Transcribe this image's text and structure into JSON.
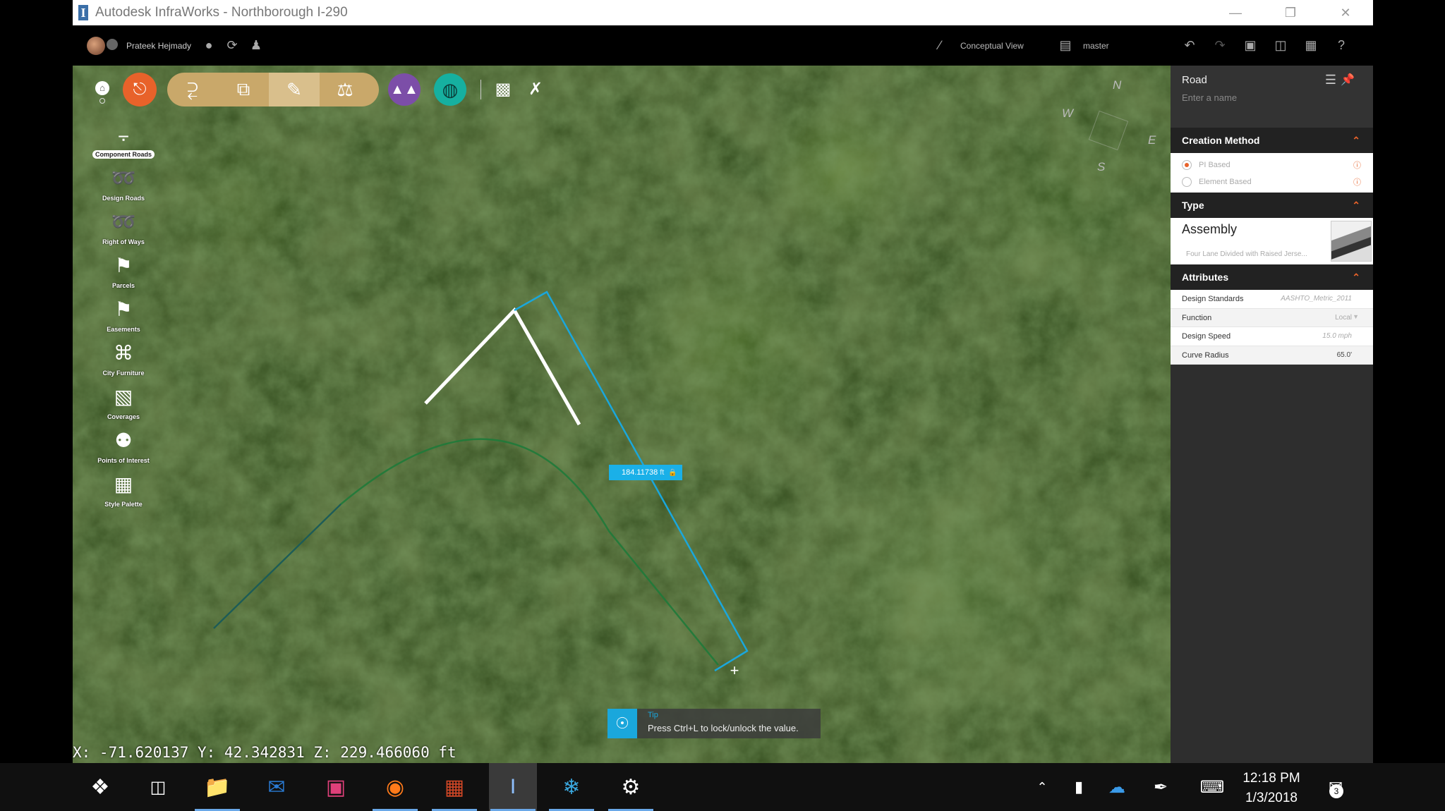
{
  "window": {
    "title": "Autodesk InfraWorks - Northborough I-290",
    "app_icon": "I",
    "controls": [
      "minimize-icon",
      "restore-icon",
      "close-icon"
    ]
  },
  "header": {
    "user_name": "Prateek Hejmady",
    "view_mode": "Conceptual View",
    "branch": "master"
  },
  "left_tools": [
    {
      "label": "Component Roads",
      "icon": "component-roads-icon",
      "active": true
    },
    {
      "label": "Design Roads",
      "icon": "design-roads-icon"
    },
    {
      "label": "Right of Ways",
      "icon": "right-of-ways-icon"
    },
    {
      "label": "Parcels",
      "icon": "parcels-icon"
    },
    {
      "label": "Easements",
      "icon": "easements-icon"
    },
    {
      "label": "City Furniture",
      "icon": "city-furniture-icon"
    },
    {
      "label": "Coverages",
      "icon": "coverages-icon"
    },
    {
      "label": "Points of Interest",
      "icon": "points-of-interest-icon"
    },
    {
      "label": "Style Palette",
      "icon": "style-palette-icon"
    }
  ],
  "compass": {
    "n": "N",
    "e": "E",
    "s": "S",
    "w": "W"
  },
  "measurement": {
    "value": "184.11738",
    "unit": "ft"
  },
  "tip": {
    "title": "Tip",
    "text": "Press Ctrl+L to lock/unlock the value."
  },
  "coords": {
    "text": "X: -71.620137 Y: 42.342831 Z: 229.466060 ft"
  },
  "panel": {
    "title": "Road",
    "name_placeholder": "Enter a name",
    "creation_method": {
      "header": "Creation Method",
      "options": [
        {
          "label": "PI Based",
          "selected": true
        },
        {
          "label": "Element Based",
          "selected": false
        }
      ]
    },
    "type": {
      "header": "Type",
      "name": "Assembly",
      "description": "Four Lane Divided with Raised Jerse..."
    },
    "attributes": {
      "header": "Attributes",
      "rows": [
        {
          "label": "Design Standards",
          "value": "AASHTO_Metric_2011"
        },
        {
          "label": "Function",
          "value": "Local"
        },
        {
          "label": "Design Speed",
          "value": "15.0 mph"
        },
        {
          "label": "Curve Radius",
          "value": "65.0'"
        }
      ]
    }
  },
  "taskbar": {
    "time": "12:18 PM",
    "date": "1/3/2018",
    "notification_count": "3"
  },
  "colors": {
    "accent_orange": "#e8622a",
    "measure_blue": "#1ab0e8",
    "toolbar_tan": "#c9a86a",
    "toolbar_purple": "#7c4ea8",
    "toolbar_teal": "#16b0a0"
  }
}
